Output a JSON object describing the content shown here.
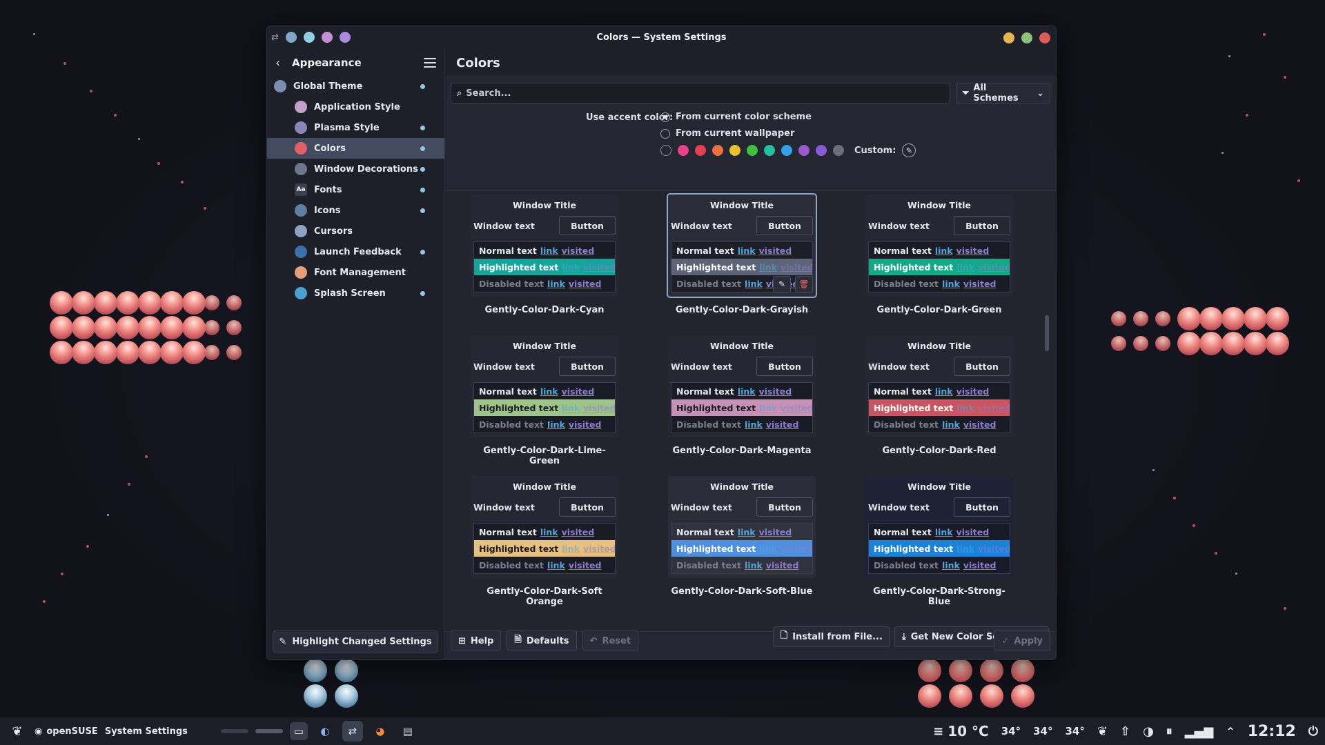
{
  "window": {
    "title": "Colors — System Settings",
    "title_dots": [
      "#7fa7c9",
      "#8fcfe0",
      "#c48fd6",
      "#a98be0"
    ],
    "controls": [
      {
        "name": "minimize-button",
        "color": "#e6b64d"
      },
      {
        "name": "maximize-button",
        "color": "#8fc07a"
      },
      {
        "name": "close-button",
        "color": "#e05a5a"
      }
    ]
  },
  "sidebar": {
    "header": "Appearance",
    "items": [
      {
        "label": "Global Theme",
        "icon": "global-theme-icon",
        "color": "#7a8fb0",
        "changed": true,
        "top": true
      },
      {
        "label": "Application Style",
        "icon": "application-style-icon",
        "color": "#c4a1c8",
        "changed": false
      },
      {
        "label": "Plasma Style",
        "icon": "plasma-style-icon",
        "color": "#8a84b8",
        "changed": true
      },
      {
        "label": "Colors",
        "icon": "colors-icon",
        "color": "#e0606a",
        "changed": true,
        "active": true
      },
      {
        "label": "Window Decorations",
        "icon": "window-decorations-icon",
        "color": "#6d7590",
        "changed": true
      },
      {
        "label": "Fonts",
        "icon": "fonts-icon",
        "color": "#3a3f50",
        "changed": true,
        "glyph": "Aa"
      },
      {
        "label": "Icons",
        "icon": "icons-icon",
        "color": "#5f7fa0",
        "changed": true
      },
      {
        "label": "Cursors",
        "icon": "cursors-icon",
        "color": "#8fa3c0",
        "changed": false
      },
      {
        "label": "Launch Feedback",
        "icon": "launch-feedback-icon",
        "color": "#3d6ea8",
        "changed": true
      },
      {
        "label": "Font Management",
        "icon": "font-management-icon",
        "color": "#e3a07a",
        "changed": false
      },
      {
        "label": "Splash Screen",
        "icon": "splash-screen-icon",
        "color": "#4aa0d0",
        "changed": true
      }
    ],
    "footer_button": "Highlight Changed Settings"
  },
  "main": {
    "title": "Colors",
    "search_placeholder": "Search...",
    "filter": "All Schemes",
    "accent_label": "Use accent color:",
    "accent_options": [
      "From current color scheme",
      "From current wallpaper"
    ],
    "accent_selected": 0,
    "swatches": [
      "",
      "#e8408a",
      "#e04050",
      "#ee7040",
      "#e8c030",
      "#40c040",
      "#20c0a0",
      "#30a0e8",
      "#9b59d0",
      "#8a5ad8",
      "#6a6e78"
    ],
    "custom_label": "Custom:",
    "schemes": [
      {
        "name": "Gently-Color-Dark-Cyan",
        "bg": "#252733",
        "view": "#1a1c25",
        "hl": "#16a49a",
        "hlText": "#ffffff",
        "selected": false
      },
      {
        "name": "Gently-Color-Dark-Grayish",
        "bg": "#2a2d38",
        "view": "#1d1f28",
        "hl": "#5d6478",
        "hlText": "#ffffff",
        "selected": true
      },
      {
        "name": "Gently-Color-Dark-Green",
        "bg": "#252733",
        "view": "#1a1c25",
        "hl": "#14a888",
        "hlText": "#ffffff",
        "selected": false
      },
      {
        "name": "Gently-Color-Dark-Lime-Green",
        "bg": "#252733",
        "view": "#1a1c25",
        "hl": "#9dc389",
        "hlText": "#1a1c25",
        "selected": false
      },
      {
        "name": "Gently-Color-Dark-Magenta",
        "bg": "#252733",
        "view": "#1a1c25",
        "hl": "#c592b6",
        "hlText": "#1a1c25",
        "selected": false
      },
      {
        "name": "Gently-Color-Dark-Red",
        "bg": "#252733",
        "view": "#1a1c25",
        "hl": "#c95560",
        "hlText": "#ffffff",
        "selected": false
      },
      {
        "name": "Gently-Color-Dark-Soft Orange",
        "bg": "#252733",
        "view": "#1a1c25",
        "hl": "#e8c080",
        "hlText": "#1a1c25",
        "selected": false
      },
      {
        "name": "Gently-Color-Dark-Soft-Blue",
        "bg": "#2a2d38",
        "view": "#30333e",
        "hl": "#4f8fe0",
        "hlText": "#ffffff",
        "selected": false
      },
      {
        "name": "Gently-Color-Dark-Strong-Blue",
        "bg": "#1f2234",
        "view": "#181a28",
        "hl": "#1a82d8",
        "hlText": "#ffffff",
        "selected": false
      }
    ],
    "preview": {
      "window_title": "Window Title",
      "window_text": "Window text",
      "button": "Button",
      "normal": "Normal text",
      "highlighted": "Highlighted text",
      "disabled": "Disabled text",
      "link": "link",
      "visited": "visited"
    },
    "install_button": "Install from File...",
    "get_new_button": "Get New Color Schemes...",
    "help_button": "Help",
    "defaults_button": "Defaults",
    "reset_button": "Reset",
    "apply_button": "Apply"
  },
  "taskbar": {
    "distro": "openSUSE",
    "active_app": "System Settings",
    "weather": "10 °C",
    "temps": [
      "34°",
      "34°",
      "34°"
    ],
    "clock": "12:12"
  }
}
